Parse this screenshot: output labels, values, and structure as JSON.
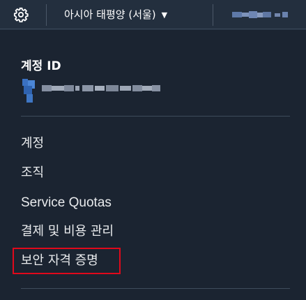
{
  "topbar": {
    "settings_icon": "gear-icon",
    "region_label": "아시아 태평양 (서울)",
    "region_caret_icon": "caret-down-icon",
    "account_name": "(blurred)"
  },
  "account_panel": {
    "section_title": "계정 ID",
    "account_id": "(blurred)",
    "menu_items": [
      {
        "label": "계정"
      },
      {
        "label": "조직"
      },
      {
        "label": "Service Quotas"
      },
      {
        "label": "결제 및 비용 관리"
      },
      {
        "label": "보안 자격 증명"
      }
    ],
    "highlighted_item": "보안 자격 증명"
  },
  "colors": {
    "topbar_bg": "#232f3e",
    "panel_bg": "#1b2431",
    "text": "#e9ebed",
    "highlight": "#e0091b"
  }
}
